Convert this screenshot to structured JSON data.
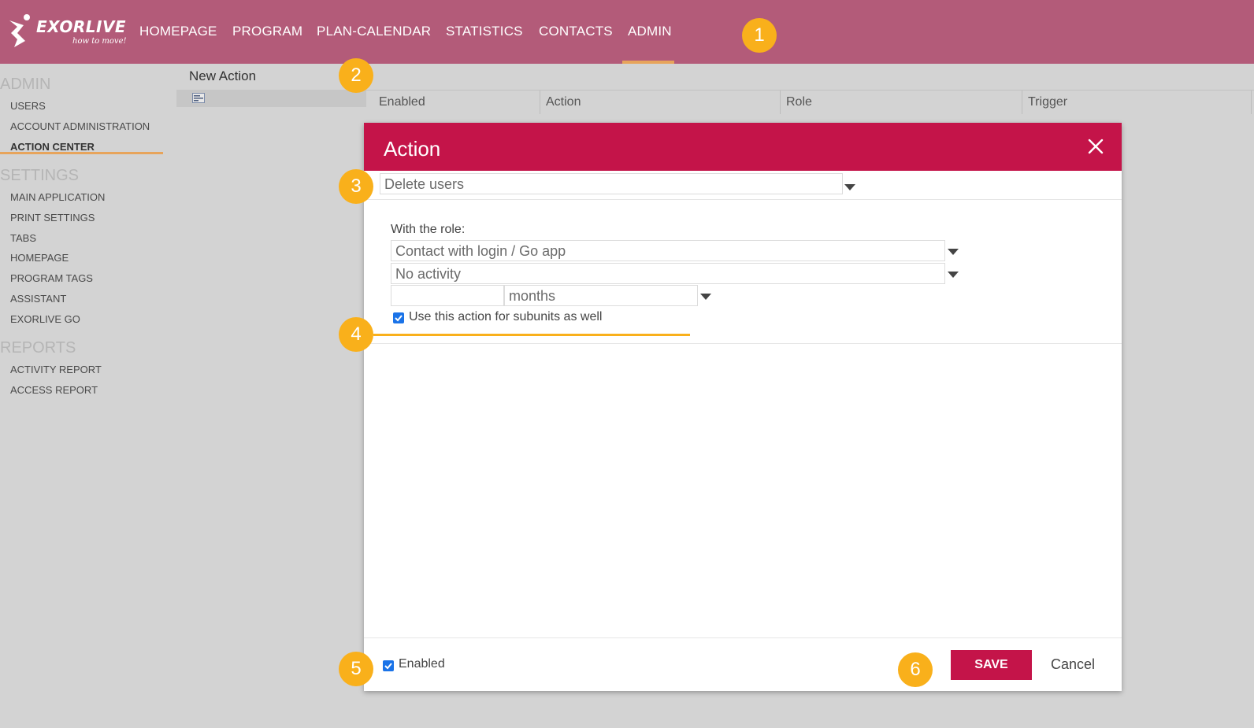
{
  "app": {
    "logo_text": "EXORLIVE",
    "logo_tagline": "how to move!"
  },
  "nav": {
    "items": [
      "HOMEPAGE",
      "PROGRAM",
      "PLAN-CALENDAR",
      "STATISTICS",
      "CONTACTS",
      "ADMIN"
    ],
    "active": "ADMIN"
  },
  "badges": [
    "1",
    "2",
    "3",
    "4",
    "5",
    "6"
  ],
  "sidebar": {
    "sections": [
      {
        "title": "ADMIN",
        "items": [
          "USERS",
          "ACCOUNT ADMINISTRATION",
          "ACTION CENTER"
        ]
      },
      {
        "title": "SETTINGS",
        "items": [
          "MAIN APPLICATION",
          "PRINT SETTINGS",
          "TABS",
          "HOMEPAGE",
          "PROGRAM TAGS",
          "ASSISTANT",
          "EXORLIVE GO"
        ]
      },
      {
        "title": "REPORTS",
        "items": [
          "ACTIVITY REPORT",
          "ACCESS REPORT"
        ]
      }
    ],
    "active_item": "ACTION CENTER"
  },
  "list_panel": {
    "title": "New Action"
  },
  "grid": {
    "columns": [
      "Enabled",
      "Action",
      "Role",
      "Trigger"
    ]
  },
  "modal": {
    "title": "Action",
    "action_select": "Delete users",
    "role_label": "With the role:",
    "role_select": "Contact with login / Go app",
    "trigger_select": "No activity",
    "period_value": "",
    "period_unit": "months",
    "subunits_label": "Use this action for subunits as well",
    "subunits_checked": true,
    "enabled_label": "Enabled",
    "enabled_checked": true,
    "save_label": "SAVE",
    "cancel_label": "Cancel"
  },
  "colors": {
    "topbar": "#b35b79",
    "modal_header": "#c41449",
    "accent_orange": "#f9b01b",
    "checkbox_blue": "#1a73e8"
  }
}
